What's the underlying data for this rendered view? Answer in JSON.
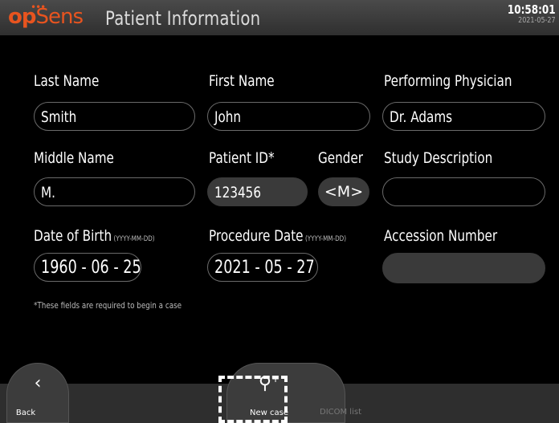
{
  "header": {
    "logo_op": "op",
    "logo_sens": "Sens",
    "title": "Patient Information",
    "time": "10:58:01",
    "date": "2021-05-27"
  },
  "form": {
    "last_name": {
      "label": "Last Name",
      "value": "Smith"
    },
    "first_name": {
      "label": "First Name",
      "value": "John"
    },
    "physician": {
      "label": "Performing Physician",
      "value": "Dr. Adams"
    },
    "middle_name": {
      "label": "Middle Name",
      "value": "M."
    },
    "patient_id": {
      "label": "Patient ID*",
      "value": "123456"
    },
    "gender": {
      "label": "Gender",
      "value": "<M>"
    },
    "study_description": {
      "label": "Study Description",
      "value": ""
    },
    "dob": {
      "label": "Date of Birth",
      "format": "(YYYY-MM-DD)",
      "value": "1960 - 06 - 25"
    },
    "procedure_date": {
      "label": "Procedure Date",
      "format": "(YYYY-MM-DD)",
      "value": "2021 - 05 - 27"
    },
    "accession_number": {
      "label": "Accession Number",
      "value": ""
    },
    "required_note": "*These fields are required to begin a case"
  },
  "footer": {
    "back_label": "Back",
    "new_case_label": "New case",
    "dicom_label": "DICOM list"
  },
  "colors": {
    "brand_orange": "#e8541f",
    "field_border": "#6a6a6a",
    "filled_bg": "#3a3a3a"
  }
}
